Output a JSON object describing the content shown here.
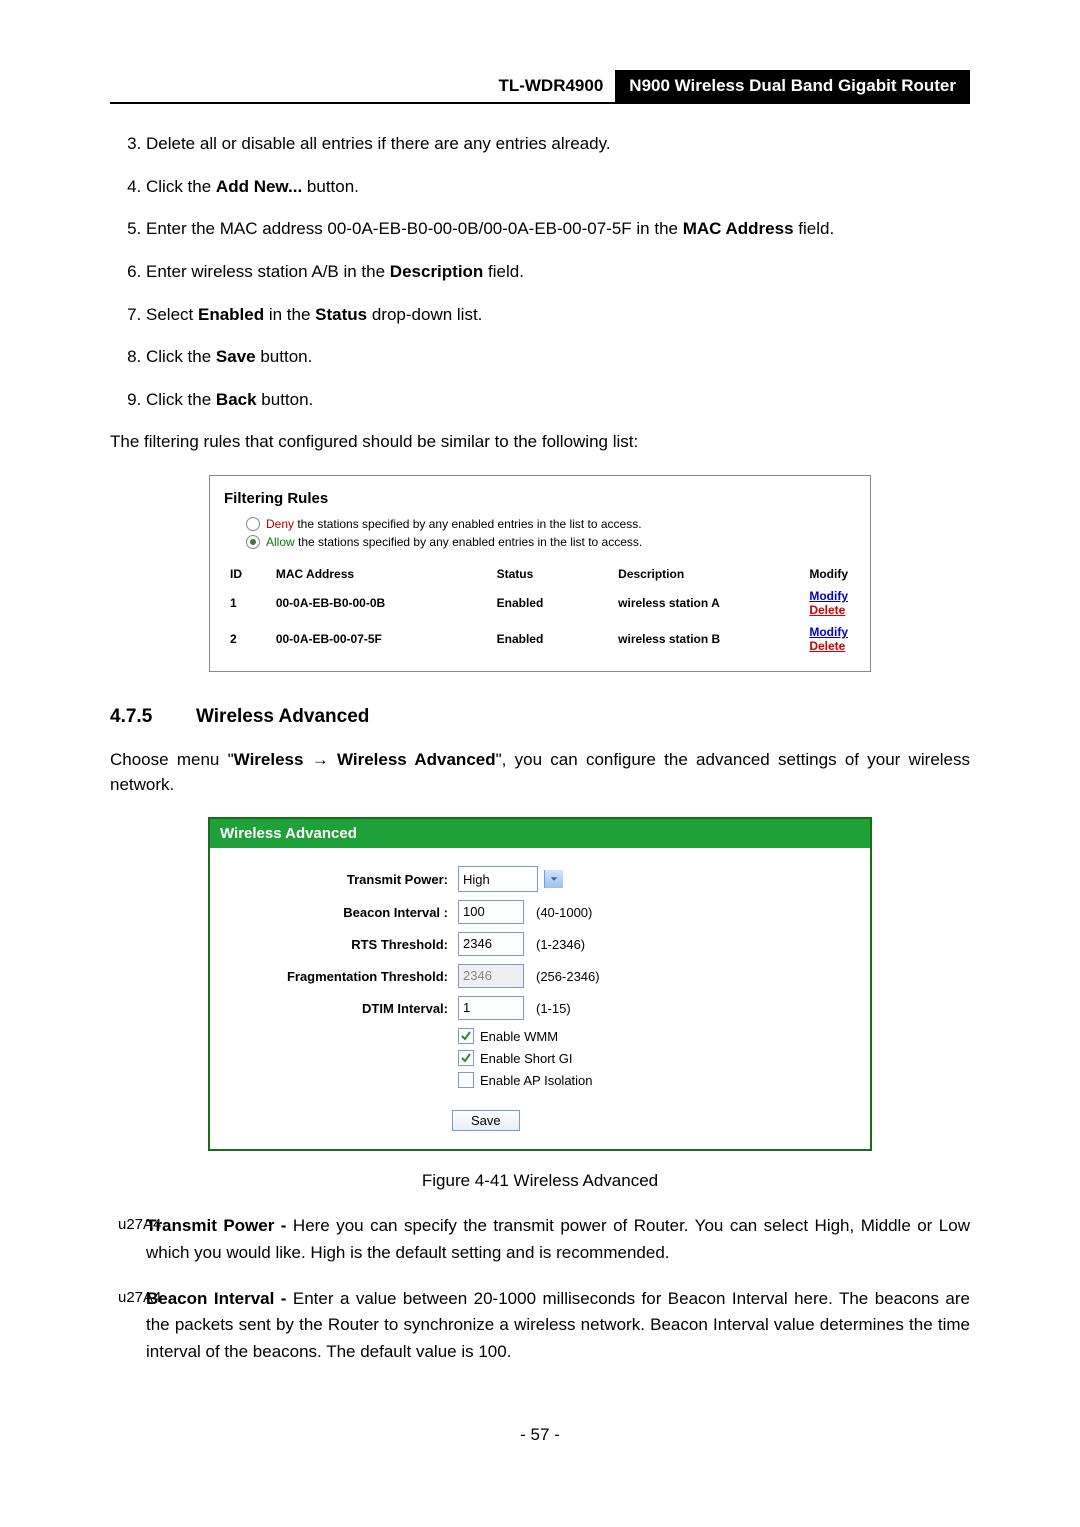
{
  "header": {
    "model": "TL-WDR4900",
    "product": "N900 Wireless Dual Band Gigabit Router"
  },
  "steps": {
    "s3": "Delete all or disable all entries if there are any entries already.",
    "s4_a": "Click the ",
    "s4_b": "Add New...",
    "s4_c": " button.",
    "s5_a": "Enter the MAC address 00-0A-EB-B0-00-0B/00-0A-EB-00-07-5F in the ",
    "s5_b": "MAC Address",
    "s5_c": " field.",
    "s6_a": "Enter wireless station A/B in the ",
    "s6_b": "Description",
    "s6_c": " field.",
    "s7_a": "Select ",
    "s7_b": "Enabled",
    "s7_c": " in the ",
    "s7_d": "Status",
    "s7_e": " drop-down list.",
    "s8_a": "Click the ",
    "s8_b": "Save",
    "s8_c": " button.",
    "s9_a": "Click the ",
    "s9_b": "Back",
    "s9_c": " button."
  },
  "intro_rules": "The filtering rules that configured should be similar to the following list:",
  "filtering": {
    "title": "Filtering Rules",
    "deny_kw": "Deny",
    "deny_rest": " the stations specified by any enabled entries in the list to access.",
    "allow_kw": "Allow",
    "allow_rest": " the stations specified by any enabled entries in the list to access.",
    "cols": {
      "id": "ID",
      "mac": "MAC Address",
      "status": "Status",
      "desc": "Description",
      "modify": "Modify"
    },
    "rows": [
      {
        "id": "1",
        "mac": "00-0A-EB-B0-00-0B",
        "status": "Enabled",
        "desc": "wireless station A",
        "m": "Modify",
        "d": "Delete"
      },
      {
        "id": "2",
        "mac": "00-0A-EB-00-07-5F",
        "status": "Enabled",
        "desc": "wireless station B",
        "m": "Modify",
        "d": "Delete"
      }
    ]
  },
  "section": {
    "num": "4.7.5",
    "title": "Wireless Advanced"
  },
  "section_intro_a": "Choose menu \"",
  "section_intro_b": "Wireless",
  "section_intro_arrow": "  →  ",
  "section_intro_c": "Wireless Advanced",
  "section_intro_d": "\", you can configure the advanced settings of your wireless network.",
  "wa": {
    "header": "Wireless Advanced",
    "labels": {
      "tx": "Transmit Power:",
      "beacon": "Beacon Interval :",
      "rts": "RTS Threshold:",
      "frag": "Fragmentation Threshold:",
      "dtim": "DTIM Interval:"
    },
    "values": {
      "tx": "High",
      "beacon": "100",
      "rts": "2346",
      "frag": "2346",
      "dtim": "1"
    },
    "hints": {
      "beacon": "(40-1000)",
      "rts": "(1-2346)",
      "frag": "(256-2346)",
      "dtim": "(1-15)"
    },
    "checks": {
      "wmm": "Enable WMM",
      "sgi": "Enable Short GI",
      "api": "Enable AP Isolation"
    },
    "save": "Save"
  },
  "fig_caption": "Figure 4-41 Wireless Advanced",
  "bullets": {
    "b1_a": "Transmit Power -",
    "b1_b": " Here you can specify the transmit power of Router. You can select High, Middle or Low which you would like. High is the default setting and is recommended.",
    "b2_a": "Beacon Interval -",
    "b2_b": " Enter a value between 20-1000 milliseconds for Beacon Interval here. The beacons are the packets sent by the Router to synchronize a wireless network. Beacon Interval value determines the time interval of the beacons. The default value is 100."
  },
  "page_number": "- 57 -"
}
